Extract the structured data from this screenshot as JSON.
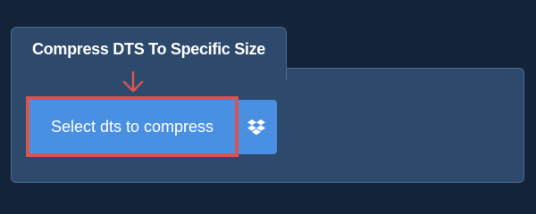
{
  "tool": {
    "tab_title": "Compress DTS To Specific Size",
    "select_button_label": "Select dts to compress"
  },
  "icons": {
    "pointer": "arrow-down-icon",
    "cloud": "dropbox-icon"
  },
  "colors": {
    "page_background": "#13233a",
    "panel": "#2d4a6d",
    "button": "#4a90e2",
    "highlight": "#d9534f"
  }
}
